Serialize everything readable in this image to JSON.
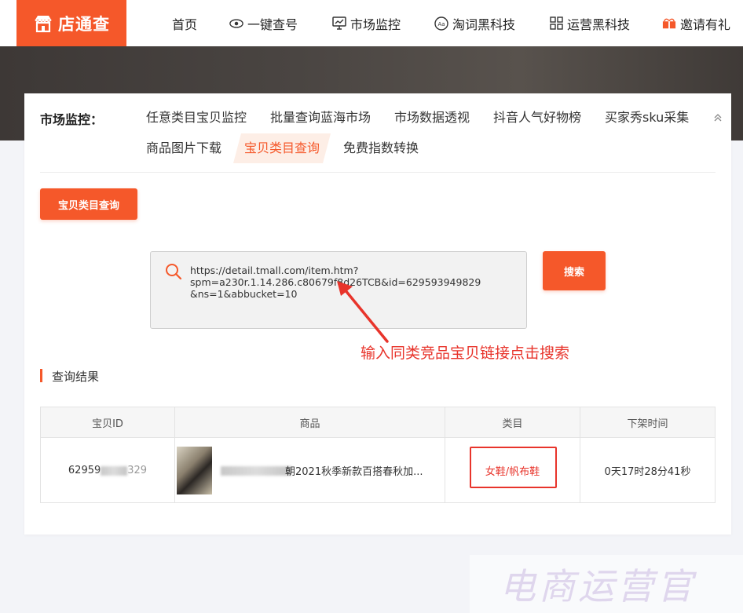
{
  "brand": {
    "name": "店通查",
    "color": "#f5582a"
  },
  "nav": {
    "items": [
      {
        "label": "首页",
        "icon": ""
      },
      {
        "label": "一键查号",
        "icon": "eye-icon"
      },
      {
        "label": "市场监控",
        "icon": "monitor-icon"
      },
      {
        "label": "淘词黑科技",
        "icon": "word-icon"
      },
      {
        "label": "运营黑科技",
        "icon": "grid-icon"
      },
      {
        "label": "邀请有礼",
        "icon": "gift-icon"
      }
    ]
  },
  "market": {
    "label": "市场监控：",
    "tabs": [
      "任意类目宝贝监控",
      "批量查询蓝海市场",
      "市场数据透视",
      "抖音人气好物榜",
      "买家秀sku采集",
      "商品图片下载",
      "宝贝类目查询",
      "免费指数转换"
    ],
    "active_tab": "宝贝类目查询"
  },
  "tool_button": "宝贝类目查询",
  "search": {
    "value": "https://detail.tmall.com/item.htm?\nspm=a230r.1.14.286.c80679f8d26TCB&id=629593949829\n&ns=1&abbucket=10",
    "button": "搜索"
  },
  "annotation": "输入同类竞品宝贝链接点击搜索",
  "results": {
    "title": "查询结果",
    "columns": [
      "宝贝ID",
      "商品",
      "类目",
      "下架时间"
    ],
    "rows": [
      {
        "id_prefix": "62959",
        "id_suffix": "329",
        "product_visible": "朝2021秋季新款百搭春秋加...",
        "category": "女鞋/帆布鞋",
        "delist_time": "0天17时28分41秒"
      }
    ]
  },
  "watermark": "电商运营官"
}
